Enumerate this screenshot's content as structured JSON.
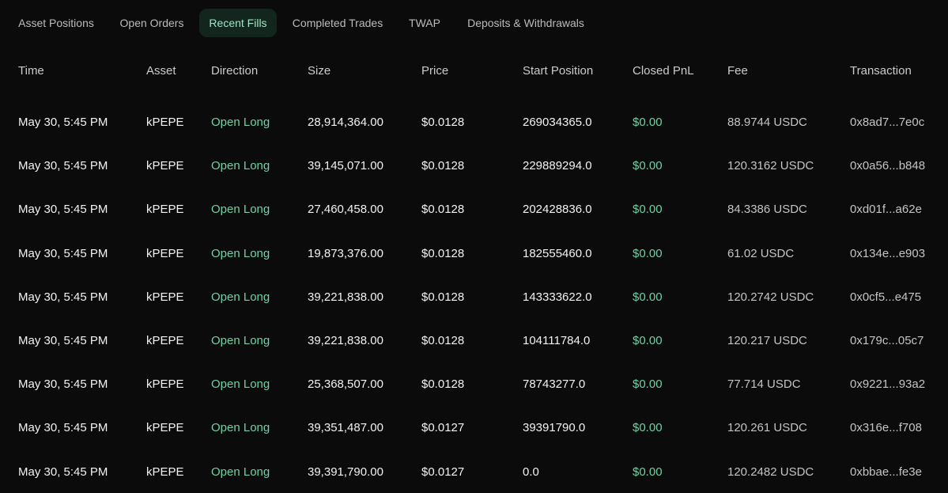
{
  "tabs": [
    {
      "label": "Asset Positions",
      "active": false
    },
    {
      "label": "Open Orders",
      "active": false
    },
    {
      "label": "Recent Fills",
      "active": true
    },
    {
      "label": "Completed Trades",
      "active": false
    },
    {
      "label": "TWAP",
      "active": false
    },
    {
      "label": "Deposits & Withdrawals",
      "active": false
    }
  ],
  "columns": {
    "time": "Time",
    "asset": "Asset",
    "direction": "Direction",
    "size": "Size",
    "price": "Price",
    "start_position": "Start Position",
    "closed_pnl": "Closed PnL",
    "fee": "Fee",
    "transaction": "Transaction"
  },
  "rows": [
    {
      "time": "May 30, 5:45 PM",
      "asset": "kPEPE",
      "direction": "Open Long",
      "size": "28,914,364.00",
      "price": "$0.0128",
      "start_position": "269034365.0",
      "closed_pnl": "$0.00",
      "fee": "88.9744 USDC",
      "transaction": "0x8ad7...7e0c"
    },
    {
      "time": "May 30, 5:45 PM",
      "asset": "kPEPE",
      "direction": "Open Long",
      "size": "39,145,071.00",
      "price": "$0.0128",
      "start_position": "229889294.0",
      "closed_pnl": "$0.00",
      "fee": "120.3162 USDC",
      "transaction": "0x0a56...b848"
    },
    {
      "time": "May 30, 5:45 PM",
      "asset": "kPEPE",
      "direction": "Open Long",
      "size": "27,460,458.00",
      "price": "$0.0128",
      "start_position": "202428836.0",
      "closed_pnl": "$0.00",
      "fee": "84.3386 USDC",
      "transaction": "0xd01f...a62e"
    },
    {
      "time": "May 30, 5:45 PM",
      "asset": "kPEPE",
      "direction": "Open Long",
      "size": "19,873,376.00",
      "price": "$0.0128",
      "start_position": "182555460.0",
      "closed_pnl": "$0.00",
      "fee": "61.02 USDC",
      "transaction": "0x134e...e903"
    },
    {
      "time": "May 30, 5:45 PM",
      "asset": "kPEPE",
      "direction": "Open Long",
      "size": "39,221,838.00",
      "price": "$0.0128",
      "start_position": "143333622.0",
      "closed_pnl": "$0.00",
      "fee": "120.2742 USDC",
      "transaction": "0x0cf5...e475"
    },
    {
      "time": "May 30, 5:45 PM",
      "asset": "kPEPE",
      "direction": "Open Long",
      "size": "39,221,838.00",
      "price": "$0.0128",
      "start_position": "104111784.0",
      "closed_pnl": "$0.00",
      "fee": "120.217 USDC",
      "transaction": "0x179c...05c7"
    },
    {
      "time": "May 30, 5:45 PM",
      "asset": "kPEPE",
      "direction": "Open Long",
      "size": "25,368,507.00",
      "price": "$0.0128",
      "start_position": "78743277.0",
      "closed_pnl": "$0.00",
      "fee": "77.714 USDC",
      "transaction": "0x9221...93a2"
    },
    {
      "time": "May 30, 5:45 PM",
      "asset": "kPEPE",
      "direction": "Open Long",
      "size": "39,351,487.00",
      "price": "$0.0127",
      "start_position": "39391790.0",
      "closed_pnl": "$0.00",
      "fee": "120.261 USDC",
      "transaction": "0x316e...f708"
    },
    {
      "time": "May 30, 5:45 PM",
      "asset": "kPEPE",
      "direction": "Open Long",
      "size": "39,391,790.00",
      "price": "$0.0127",
      "start_position": "0.0",
      "closed_pnl": "$0.00",
      "fee": "120.2482 USDC",
      "transaction": "0xbbae...fe3e"
    }
  ],
  "colors": {
    "background": "#0b0b0b",
    "accent_green": "#6fd1a4",
    "active_tab_bg": "#12261e",
    "active_tab_text": "#9ae8c4"
  }
}
